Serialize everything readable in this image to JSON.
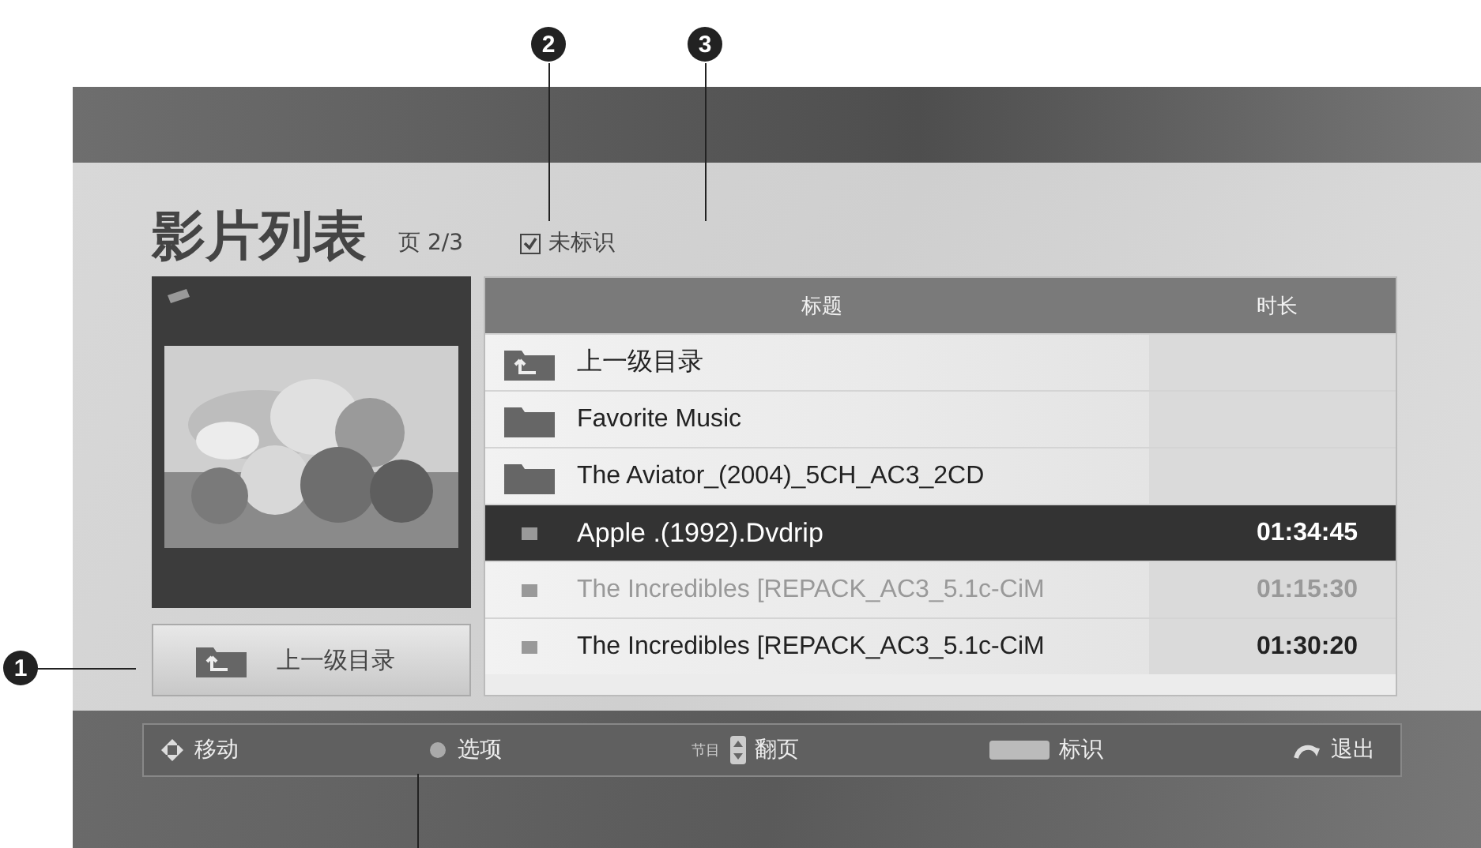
{
  "title": "影片列表",
  "page": "页 2/3",
  "mark_filter": {
    "label": "未标识",
    "checked": true
  },
  "up_button": {
    "label": "上一级目录"
  },
  "table": {
    "columns": [
      "标题",
      "时长"
    ],
    "rows": [
      {
        "kind": "up",
        "title": "上一级目录",
        "duration": "",
        "selected": false,
        "dimmed": false
      },
      {
        "kind": "folder",
        "title": "Favorite Music",
        "duration": "",
        "selected": false,
        "dimmed": false
      },
      {
        "kind": "folder",
        "title": "The Aviator_(2004)_5CH_AC3_2CD",
        "duration": "",
        "selected": false,
        "dimmed": false
      },
      {
        "kind": "video",
        "title": "Apple .(1992).Dvdrip",
        "duration": "01:34:45",
        "selected": true,
        "dimmed": false
      },
      {
        "kind": "video",
        "title": "The Incredibles [REPACK_AC3_5.1c-CiM",
        "duration": "01:15:30",
        "selected": false,
        "dimmed": true
      },
      {
        "kind": "video",
        "title": "The Incredibles [REPACK_AC3_5.1c-CiM",
        "duration": "01:30:20",
        "selected": false,
        "dimmed": false
      }
    ]
  },
  "hints": [
    {
      "kind": "move",
      "label": "移动"
    },
    {
      "kind": "option",
      "label": "选项"
    },
    {
      "kind": "page",
      "key": "节目",
      "label": "翻页"
    },
    {
      "kind": "mark",
      "label": "标识"
    },
    {
      "kind": "exit",
      "label": "退出"
    }
  ],
  "callouts": [
    "1",
    "2",
    "3"
  ]
}
